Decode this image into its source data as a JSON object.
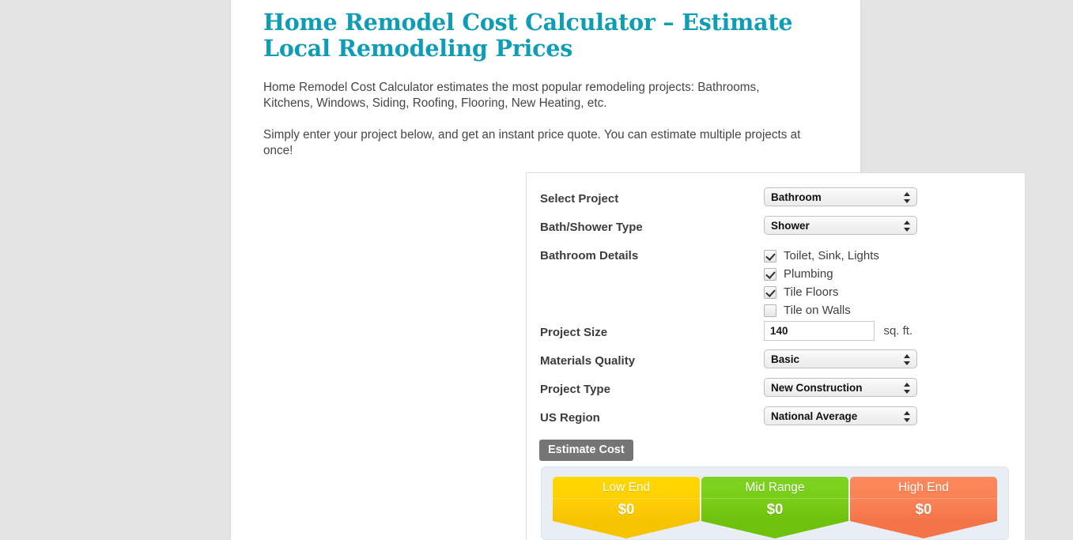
{
  "article": {
    "title": "Home Remodel Cost Calculator – Estimate Local Remodeling Prices",
    "paragraph_1": "Home Remodel Cost Calculator estimates the most popular remodeling projects: Bathrooms, Kitchens, Windows, Siding, Roofing, Flooring, New Heating, etc.",
    "paragraph_2": "Simply enter your project below, and get an instant price quote. You can estimate multiple projects at once!"
  },
  "calculator": {
    "rows": {
      "select_project": {
        "label": "Select Project",
        "value": "Bathroom"
      },
      "bath_shower_type": {
        "label": "Bath/Shower Type",
        "value": "Shower"
      },
      "bathroom_details": {
        "label": "Bathroom Details",
        "options": [
          {
            "label": "Toilet, Sink, Lights",
            "checked": true
          },
          {
            "label": "Plumbing",
            "checked": true
          },
          {
            "label": "Tile Floors",
            "checked": true
          },
          {
            "label": "Tile on Walls",
            "checked": false
          }
        ]
      },
      "project_size": {
        "label": "Project Size",
        "value": "140",
        "placeholder": "",
        "unit": "sq. ft."
      },
      "materials_quality": {
        "label": "Materials Quality",
        "value": "Basic"
      },
      "project_type": {
        "label": "Project Type",
        "value": "New Construction"
      },
      "us_region": {
        "label": "US Region",
        "value": "National Average"
      }
    },
    "submit_label": "Estimate Cost"
  },
  "results": {
    "tiers": [
      {
        "name": "Low End",
        "value": "$0",
        "color": "#ffd000"
      },
      {
        "name": "Mid Range",
        "value": "$0",
        "color": "#7ace17"
      },
      {
        "name": "High End",
        "value": "$0",
        "color": "#fa8153"
      }
    ]
  },
  "colors": {
    "title": "#0f9cb5",
    "page_background": "#e4e4e4",
    "content_background": "#ffffff",
    "button": "#757575",
    "results_background": "#e8eef3"
  }
}
